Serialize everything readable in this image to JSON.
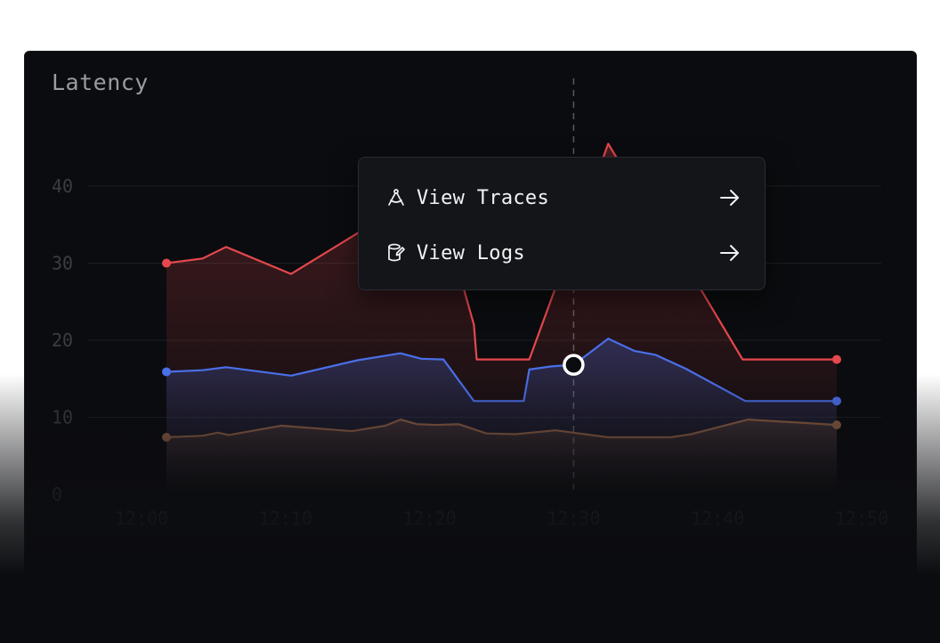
{
  "card": {
    "title": "Latency"
  },
  "menu": {
    "items": [
      {
        "label": "View Traces",
        "icon": "compass-icon"
      },
      {
        "label": "View Logs",
        "icon": "logs-icon"
      }
    ]
  },
  "colors": {
    "red": "#e5484d",
    "blue": "#4a6fe8",
    "brown": "#8c5e45",
    "grid": "#1b1d22",
    "tick": "#3a3d44",
    "crosshair": "#555a63"
  },
  "chart_data": {
    "type": "line",
    "title": "Latency",
    "xlabel": "",
    "ylabel": "",
    "ylim": [
      0,
      40
    ],
    "yticks": [
      0,
      10,
      20,
      30,
      40
    ],
    "xticks": [
      "12:00",
      "12:10",
      "12:20",
      "12:30",
      "12:40",
      "12:50"
    ],
    "xlim": [
      0,
      52
    ],
    "hover_x": 31.2,
    "series": [
      {
        "color": "red",
        "x": [
          1.8,
          4.4,
          6.1,
          10.8,
          15.6,
          18.7,
          19.3,
          21.8,
          24.0,
          24.2,
          27.6,
          28.0,
          33.7,
          35.6,
          36.8,
          37.1,
          43.4,
          43.6,
          50.2
        ],
        "y": [
          30,
          30.6,
          32.1,
          28.6,
          33.9,
          38.2,
          37.5,
          36.0,
          22.0,
          17.5,
          17.5,
          17.5,
          45.5,
          39.8,
          38.2,
          36.5,
          17.5,
          17.5,
          17.5
        ]
      },
      {
        "color": "blue",
        "x": [
          1.8,
          4.4,
          6.1,
          10.8,
          15.6,
          18.7,
          20.2,
          21.8,
          24.0,
          27.6,
          28.0,
          29.6,
          31.2,
          33.7,
          35.6,
          37.1,
          39.3,
          43.6,
          50.2
        ],
        "y": [
          15.9,
          16.1,
          16.5,
          15.4,
          17.4,
          18.3,
          17.6,
          17.5,
          12.1,
          12.1,
          16.2,
          16.6,
          16.8,
          20.2,
          18.6,
          18.1,
          16.3,
          12.1,
          12.1
        ]
      },
      {
        "color": "brown",
        "x": [
          1.8,
          4.4,
          5.5,
          6.3,
          10.1,
          15.2,
          17.6,
          18.7,
          19.9,
          21.3,
          22.9,
          24.9,
          27.0,
          29.9,
          33.7,
          38.2,
          39.7,
          43.8,
          50.2
        ],
        "y": [
          7.4,
          7.6,
          8.0,
          7.7,
          8.9,
          8.2,
          8.9,
          9.7,
          9.1,
          9.0,
          9.1,
          7.9,
          7.8,
          8.3,
          7.4,
          7.4,
          7.8,
          9.7,
          9.0
        ]
      }
    ]
  }
}
